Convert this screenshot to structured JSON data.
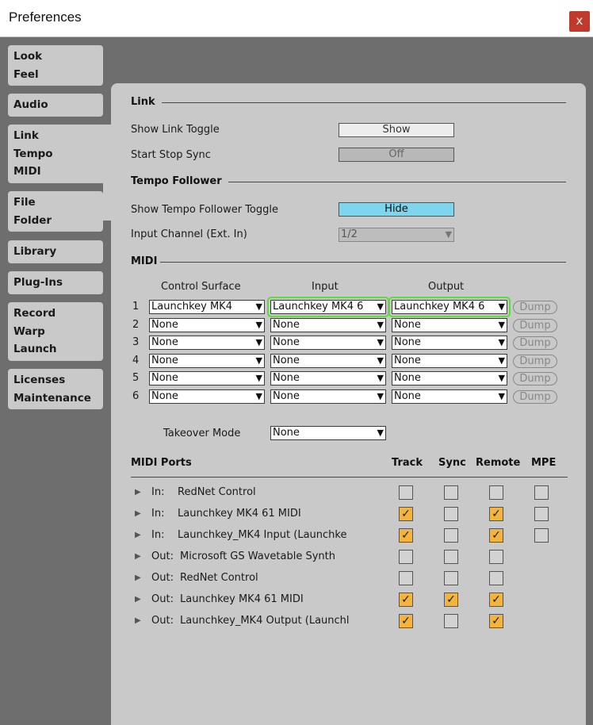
{
  "window": {
    "title": "Preferences",
    "close_glyph": "x"
  },
  "tabs": [
    {
      "lines": [
        "Look",
        "Feel"
      ]
    },
    {
      "lines": [
        "Audio"
      ]
    },
    {
      "lines": [
        "Link",
        "Tempo",
        "MIDI"
      ]
    },
    {
      "lines": [
        "File",
        "Folder"
      ]
    },
    {
      "lines": [
        "Library"
      ]
    },
    {
      "lines": [
        "Plug-Ins"
      ]
    },
    {
      "lines": [
        "Record",
        "Warp",
        "Launch"
      ]
    },
    {
      "lines": [
        "Licenses",
        "Maintenance"
      ]
    }
  ],
  "link": {
    "section": "Link",
    "show_link_toggle": {
      "label": "Show Link Toggle",
      "value": "Show"
    },
    "start_stop_sync": {
      "label": "Start Stop Sync",
      "value": "Off"
    }
  },
  "tempo_follower": {
    "section": "Tempo Follower",
    "show_toggle": {
      "label": "Show Tempo Follower Toggle",
      "value": "Hide"
    },
    "input_channel": {
      "label": "Input Channel (Ext. In)",
      "value": "1/2"
    }
  },
  "midi": {
    "section": "MIDI",
    "headers": {
      "control_surface": "Control Surface",
      "input": "Input",
      "output": "Output"
    },
    "dump_label": "Dump",
    "rows": [
      {
        "num": "1",
        "surface": "Launchkey MK4",
        "input": "Launchkey MK4 6",
        "output": "Launchkey MK4 6"
      },
      {
        "num": "2",
        "surface": "None",
        "input": "None",
        "output": "None"
      },
      {
        "num": "3",
        "surface": "None",
        "input": "None",
        "output": "None"
      },
      {
        "num": "4",
        "surface": "None",
        "input": "None",
        "output": "None"
      },
      {
        "num": "5",
        "surface": "None",
        "input": "None",
        "output": "None"
      },
      {
        "num": "6",
        "surface": "None",
        "input": "None",
        "output": "None"
      }
    ],
    "takeover": {
      "label": "Takeover Mode",
      "value": "None"
    }
  },
  "midi_ports": {
    "title": "MIDI Ports",
    "columns": {
      "track": "Track",
      "sync": "Sync",
      "remote": "Remote",
      "mpe": "MPE"
    },
    "ports": [
      {
        "dir": "In:",
        "name": "RedNet Control",
        "track": false,
        "sync": false,
        "remote": false,
        "mpe": false
      },
      {
        "dir": "In:",
        "name": "Launchkey MK4 61 MIDI",
        "track": true,
        "sync": false,
        "remote": true,
        "mpe": false
      },
      {
        "dir": "In:",
        "name": "Launchkey_MK4 Input (Launchke",
        "track": true,
        "sync": false,
        "remote": true,
        "mpe": false
      },
      {
        "dir": "Out:",
        "name": "Microsoft GS Wavetable Synth",
        "track": false,
        "sync": false,
        "remote": false
      },
      {
        "dir": "Out:",
        "name": "RedNet Control",
        "track": false,
        "sync": false,
        "remote": false
      },
      {
        "dir": "Out:",
        "name": "Launchkey MK4 61 MIDI",
        "track": true,
        "sync": true,
        "remote": true
      },
      {
        "dir": "Out:",
        "name": "Launchkey_MK4 Output (Launchl",
        "track": true,
        "sync": false,
        "remote": true
      }
    ]
  },
  "glyphs": {
    "arrow_down": "▼",
    "arrow_right": "▶",
    "check": "✓"
  },
  "colors": {
    "toggle_on": "#7dd6ee",
    "checked": "#f3b43e",
    "highlight": "#5edc3a",
    "close": "#c0392b"
  }
}
